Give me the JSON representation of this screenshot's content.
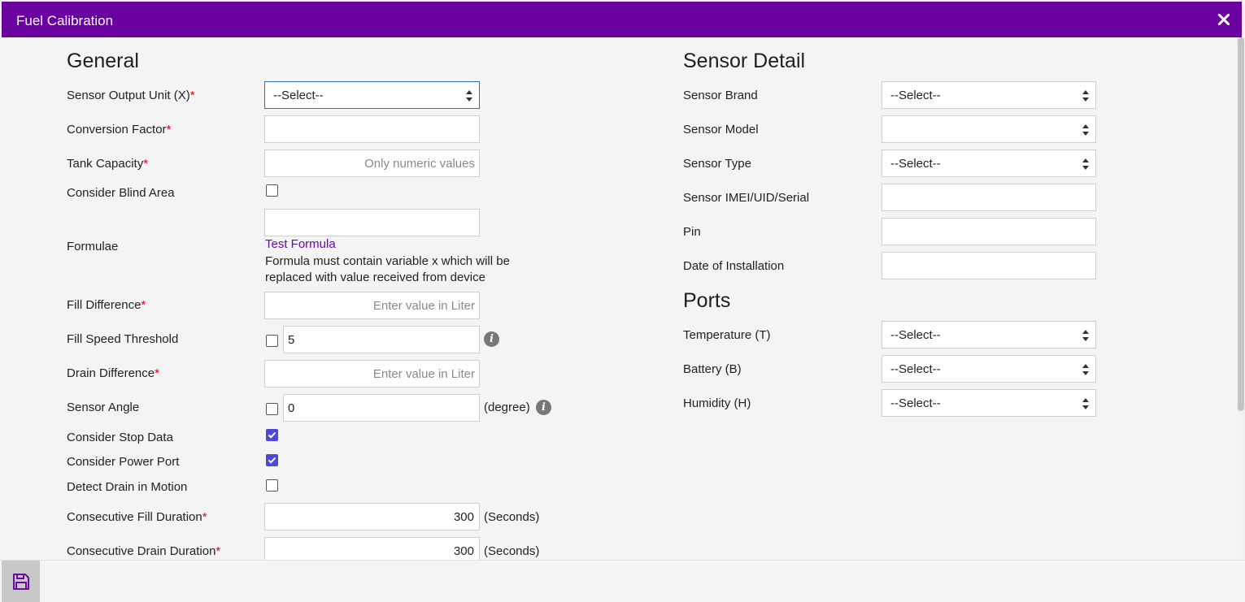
{
  "window": {
    "title": "Fuel Calibration"
  },
  "general": {
    "heading": "General",
    "sensor_output_unit": {
      "label": "Sensor Output Unit (X)",
      "value": "--Select--"
    },
    "conversion_factor": {
      "label": "Conversion Factor",
      "value": ""
    },
    "tank_capacity": {
      "label": "Tank Capacity",
      "placeholder": "Only numeric values"
    },
    "consider_blind_area": {
      "label": "Consider Blind Area",
      "checked": false
    },
    "formulae": {
      "label": "Formulae",
      "value": "",
      "link": "Test Formula",
      "note_line1": "Formula must contain variable x which will be",
      "note_line2": "replaced with value received from device"
    },
    "fill_difference": {
      "label": "Fill Difference",
      "placeholder": "Enter value in Liter"
    },
    "fill_speed_threshold": {
      "label": "Fill Speed Threshold",
      "value": "5",
      "checked": false
    },
    "drain_difference": {
      "label": "Drain Difference",
      "placeholder": "Enter value in Liter"
    },
    "sensor_angle": {
      "label": "Sensor Angle",
      "value": "0",
      "unit": "(degree)",
      "checked": false
    },
    "consider_stop_data": {
      "label": "Consider Stop Data",
      "checked": true
    },
    "consider_power_port": {
      "label": "Consider Power Port",
      "checked": true
    },
    "detect_drain_in_motion": {
      "label": "Detect Drain in Motion",
      "checked": false
    },
    "consecutive_fill_duration": {
      "label": "Consecutive Fill Duration",
      "value": "300",
      "unit": "(Seconds)"
    },
    "consecutive_drain_duration": {
      "label": "Consecutive Drain Duration",
      "value": "300",
      "unit": "(Seconds)"
    },
    "required_mark": "*"
  },
  "sensor_detail": {
    "heading": "Sensor Detail",
    "brand": {
      "label": "Sensor Brand",
      "value": "--Select--"
    },
    "model": {
      "label": "Sensor Model",
      "value": ""
    },
    "type": {
      "label": "Sensor Type",
      "value": "--Select--"
    },
    "imei": {
      "label": "Sensor IMEI/UID/Serial",
      "value": ""
    },
    "pin": {
      "label": "Pin",
      "value": ""
    },
    "date_of_installation": {
      "label": "Date of Installation",
      "value": ""
    }
  },
  "ports": {
    "heading": "Ports",
    "temperature": {
      "label": "Temperature (T)",
      "value": "--Select--"
    },
    "battery": {
      "label": "Battery (B)",
      "value": "--Select--"
    },
    "humidity": {
      "label": "Humidity (H)",
      "value": "--Select--"
    }
  },
  "icons": {
    "close": "close-icon",
    "info": "info-icon",
    "save": "save-icon",
    "select_arrows": "select-arrows-icon"
  },
  "colors": {
    "titlebar": "#6a00a0",
    "link": "#6a0aa0",
    "checkbox_checked": "#4b49d6",
    "required": "#e0001b",
    "focus_border": "#2f6eb5"
  }
}
